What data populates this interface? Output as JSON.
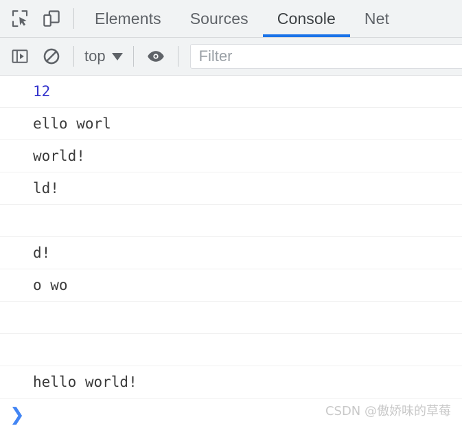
{
  "accent_color": "#1a73e8",
  "colors": {
    "toolbar_bg": "#f1f3f4",
    "body_bg": "#ffffff",
    "tab_text": "#5f6368",
    "active_tab_text": "#3c4043",
    "number_value": "#3333cc",
    "log_text": "#3b3b3b",
    "prompt_chevron": "#4285f4",
    "watermark": "#c9c9c9"
  },
  "tabbar": {
    "inspect_icon": "inspect-element-icon",
    "device_icon": "device-toolbar-icon",
    "tabs": [
      {
        "label": "Elements",
        "active": false
      },
      {
        "label": "Sources",
        "active": false
      },
      {
        "label": "Console",
        "active": true
      },
      {
        "label": "Net",
        "active": false
      }
    ]
  },
  "consolebar": {
    "sidebar_toggle_icon": "console-sidebar-icon",
    "clear_icon": "clear-console-icon",
    "context": "top",
    "context_caret": "chevron-down-icon",
    "eye_icon": "live-expression-eye-icon",
    "filter": {
      "value": "",
      "placeholder": "Filter"
    }
  },
  "console": {
    "messages": [
      {
        "text": "12",
        "type": "number"
      },
      {
        "text": "ello worl",
        "type": "string"
      },
      {
        "text": "world!",
        "type": "string"
      },
      {
        "text": "ld!",
        "type": "string"
      },
      {
        "text": "",
        "type": "empty"
      },
      {
        "text": "d!",
        "type": "string"
      },
      {
        "text": "o wo",
        "type": "string"
      },
      {
        "text": "",
        "type": "empty"
      },
      {
        "text": "",
        "type": "empty"
      },
      {
        "text": "hello world!",
        "type": "string"
      }
    ],
    "prompt": {
      "chevron": "❯",
      "input_value": ""
    }
  },
  "watermark": {
    "text": "CSDN @傲娇味的草莓"
  }
}
